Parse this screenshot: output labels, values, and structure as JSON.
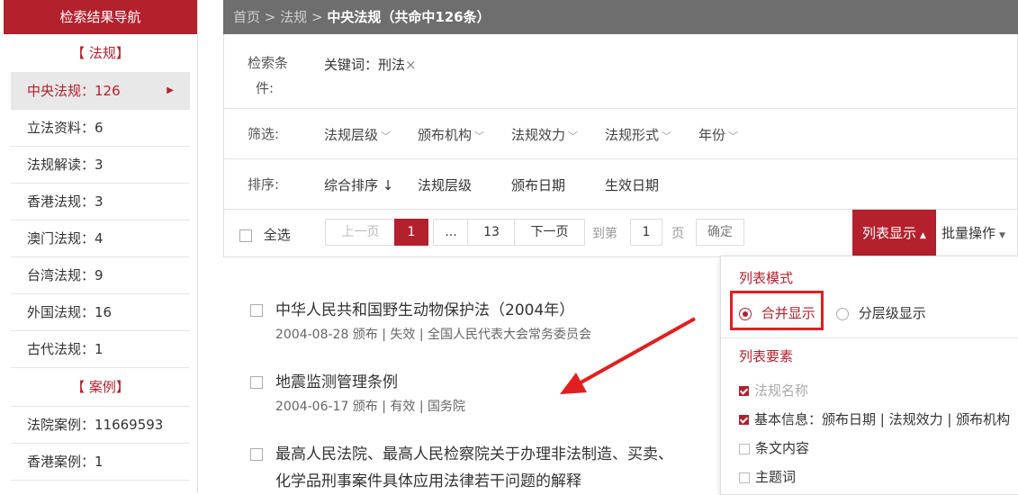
{
  "sidebar": {
    "title": "检索结果导航",
    "section_law": "【 法规】",
    "section_case": "【 案例】",
    "items": [
      {
        "label": "中央法规：126"
      },
      {
        "label": "立法资料：6"
      },
      {
        "label": "法规解读：3"
      },
      {
        "label": "香港法规：3"
      },
      {
        "label": "澳门法规：4"
      },
      {
        "label": "台湾法规：9"
      },
      {
        "label": "外国法规：16"
      },
      {
        "label": "古代法规：1"
      }
    ],
    "case_items": [
      {
        "label": "法院案例：11669593"
      },
      {
        "label": "香港案例：1"
      }
    ]
  },
  "breadcrumb": {
    "home": "首页",
    "sep": ">",
    "law": "法规",
    "current": "中央法规（共命中126条）"
  },
  "condition": {
    "label_line1": "检索条",
    "label_line2": "件:",
    "keyword": "关键词：刑法",
    "remove": "×"
  },
  "filter": {
    "label": "筛选:",
    "items": [
      "法规层级",
      "颁布机构",
      "法规效力",
      "法规形式",
      "年份"
    ]
  },
  "sort": {
    "label": "排序:",
    "items": [
      "综合排序 ↓",
      "法规层级",
      "颁布日期",
      "生效日期"
    ]
  },
  "pager": {
    "select_all": "全选",
    "prev": "上一页",
    "current": "1",
    "ellipsis": "...",
    "last": "13",
    "next": "下一页",
    "goto": "到第",
    "goto_value": "1",
    "page": "页",
    "confirm": "确定",
    "list_display": "列表显示",
    "batch": "批量操作"
  },
  "results": [
    {
      "title": "中华人民共和国野生动物保护法（2004年）",
      "meta": "2004-08-28 颁布 | 失效 | 全国人民代表大会常务委员会"
    },
    {
      "title": "地震监测管理条例",
      "meta": "2004-06-17 颁布 | 有效 | 国务院"
    },
    {
      "title": "最高人民法院、最高人民检察院关于办理非法制造、买卖、",
      "title2": "化学品刑事案件具体应用法律若干问题的解释"
    }
  ],
  "dropdown": {
    "mode_title": "列表模式",
    "merged": "合并显示",
    "layered": "分层级显示",
    "elements_title": "列表要素",
    "elements": [
      {
        "label": "法规名称",
        "checked": true
      },
      {
        "label": "基本信息：颁布日期 | 法规效力 | 颁布机构",
        "checked": true
      },
      {
        "label": "条文内容",
        "checked": false
      },
      {
        "label": "主题词",
        "checked": false
      }
    ]
  },
  "colors": {
    "brand": "#b3212d",
    "highlight": "#e02020",
    "breadcrumb_bg": "#6e6e6e"
  }
}
